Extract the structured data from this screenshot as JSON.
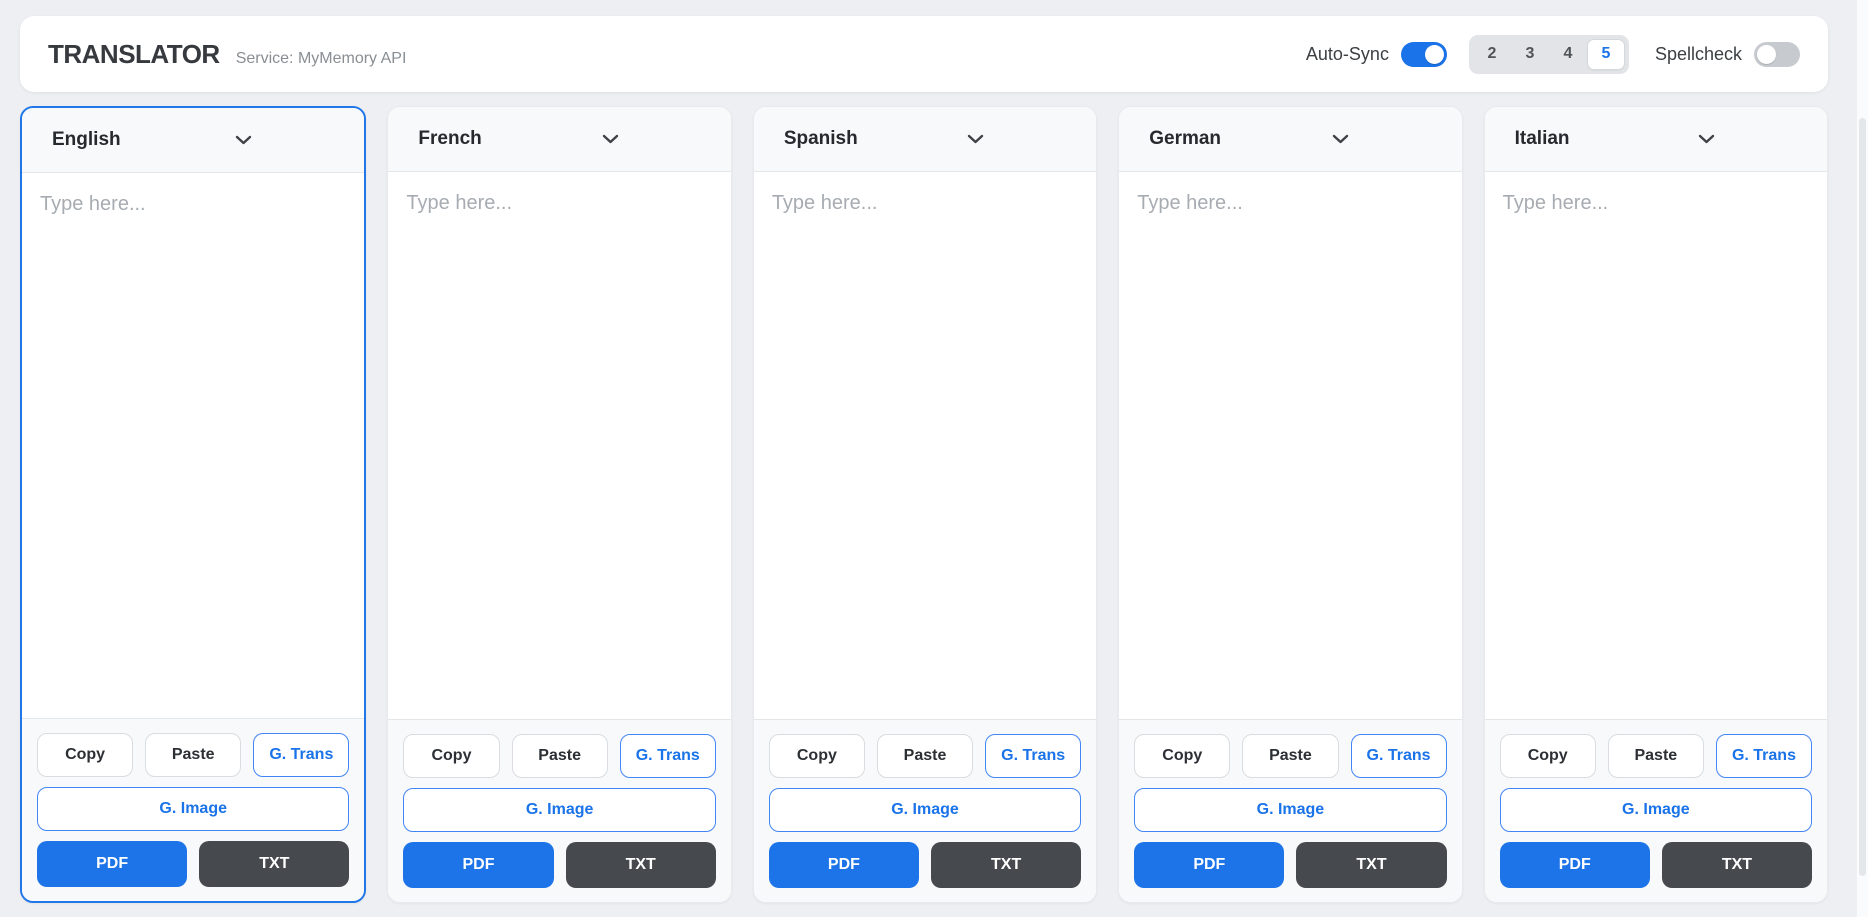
{
  "header": {
    "title": "TRANSLATOR",
    "subtitle": "Service: MyMemory API",
    "auto_sync": {
      "label": "Auto-Sync",
      "on": true
    },
    "column_count": {
      "options": [
        "2",
        "3",
        "4",
        "5"
      ],
      "selected": "5"
    },
    "spellcheck": {
      "label": "Spellcheck",
      "on": false
    }
  },
  "panel": {
    "placeholder": "Type here...",
    "buttons": {
      "copy": "Copy",
      "paste": "Paste",
      "gtrans": "G. Trans",
      "gimage": "G. Image",
      "pdf": "PDF",
      "txt": "TXT"
    }
  },
  "columns": [
    {
      "language": "English",
      "active": true,
      "text": ""
    },
    {
      "language": "French",
      "active": false,
      "text": ""
    },
    {
      "language": "Spanish",
      "active": false,
      "text": ""
    },
    {
      "language": "German",
      "active": false,
      "text": ""
    },
    {
      "language": "Italian",
      "active": false,
      "text": ""
    }
  ],
  "colors": {
    "accent": "#1a73e8",
    "dark_button": "#46494d",
    "page_bg": "#edeff2"
  }
}
